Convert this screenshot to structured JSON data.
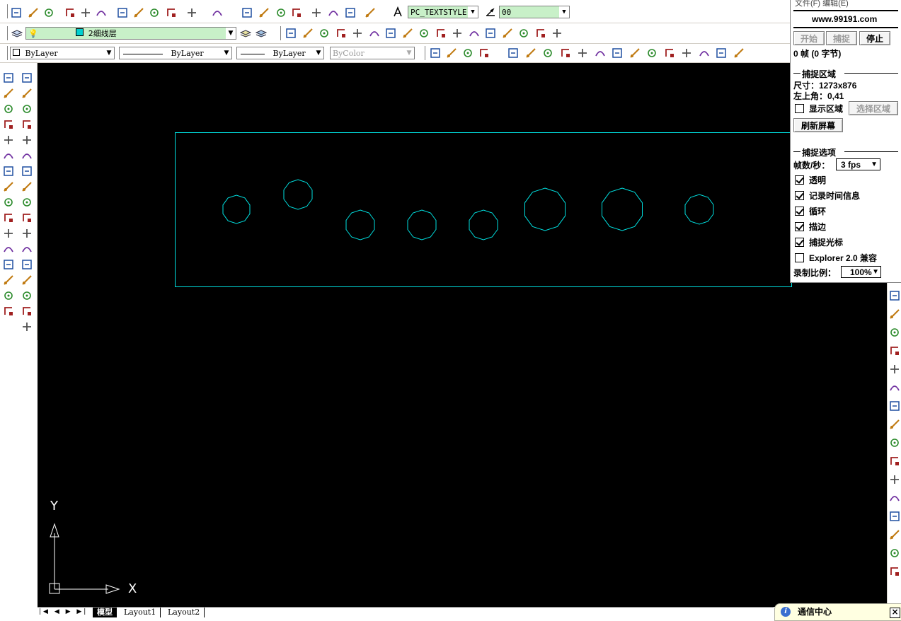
{
  "toolbar": {
    "text_style": "PC_TEXTSTYLE",
    "dim_style": "00",
    "layer_name": "2细线层",
    "color_combo": "ByLayer",
    "linetype_combo": "ByLayer",
    "lineweight_combo": "ByLayer",
    "plotstyle_combo": "ByColor",
    "icons_row1": [
      "new-icon",
      "open-icon",
      "save-icon",
      "print-icon",
      "print-preview-icon",
      "publish-icon",
      "cut-icon",
      "copy-icon",
      "paste-icon",
      "match-properties-icon",
      "undo-icon",
      "redo-icon",
      "pan-icon",
      "zoom-realtime-icon",
      "zoom-window-icon",
      "zoom-previous-icon",
      "properties-icon",
      "design-center-icon",
      "tool-palettes-icon",
      "help-icon"
    ],
    "icons_row2_snap": [
      "temporary-tracking-icon",
      "snap-from-icon",
      "snap-endpoint-icon",
      "snap-midpoint-icon",
      "snap-intersection-icon",
      "snap-apparent-intersection-icon",
      "snap-extension-icon",
      "snap-center-icon",
      "snap-quadrant-icon",
      "snap-tangent-icon",
      "snap-perpendicular-icon",
      "snap-parallel-icon",
      "snap-insert-icon",
      "snap-node-icon",
      "snap-nearest-icon",
      "snap-none-icon",
      "osnap-settings-icon"
    ],
    "icons_row3_ucs": [
      "ucs-icon",
      "named-ucs-icon",
      "ucs-previous-icon",
      "world-ucs-icon",
      "object-ucs-icon",
      "face-ucs-icon",
      "view-ucs-icon",
      "origin-ucs-icon",
      "z-axis-ucs-icon",
      "3point-ucs-icon",
      "x-rotate-ucs-icon",
      "y-rotate-ucs-icon",
      "z-rotate-ucs-icon",
      "apply-ucs-icon"
    ]
  },
  "draw_tools": [
    "line-icon",
    "construction-line-icon",
    "polyline-icon",
    "polygon-icon",
    "rectangle-icon",
    "arc-icon",
    "circle-icon",
    "revision-cloud-icon",
    "spline-icon",
    "ellipse-icon",
    "ellipse-arc-icon",
    "insert-block-icon",
    "make-block-icon",
    "point-icon",
    "hatch-icon",
    "region-icon",
    "text-icon"
  ],
  "modify_tools": [
    "erase-icon",
    "copy-object-icon",
    "mirror-icon",
    "offset-icon",
    "array-icon",
    "move-icon",
    "rotate-icon",
    "scale-icon",
    "stretch-icon",
    "trim-icon",
    "extend-icon",
    "break-at-point-icon",
    "break-icon",
    "chamfer-icon",
    "fillet-icon",
    "explode-icon"
  ],
  "layout_tabs": [
    "模型",
    "Layout1",
    "Layout2"
  ],
  "ucs_labels": {
    "x": "X",
    "y": "Y"
  },
  "drawing": {
    "line_color": "#00e0e0",
    "holes": [
      {
        "label": "small",
        "r": 20
      },
      {
        "label": "small",
        "r": 21
      },
      {
        "label": "small",
        "r": 21
      },
      {
        "label": "small",
        "r": 21
      },
      {
        "label": "small",
        "r": 21
      },
      {
        "label": "large",
        "r": 30
      },
      {
        "label": "large",
        "r": 30
      },
      {
        "label": "small",
        "r": 21
      }
    ]
  },
  "capture_panel": {
    "menu": "文件(F)    编辑(E)",
    "site": "www.99191.com",
    "start_btn": "开始",
    "capture_btn": "捕捉",
    "stop_btn": "停止",
    "frames": "0 帧 (0 字节)",
    "region_header": "捕捉区域",
    "size_label": "尺寸：1273x876",
    "topleft_label": "左上角：0,41",
    "show_region": "显示区域",
    "select_region_btn": "选择区域",
    "refresh_btn": "刷新屏幕",
    "options_header": "捕捉选项",
    "fps_label": "帧数/秒：",
    "fps_value": "3 fps",
    "opt_transparent": "透明",
    "opt_record_time": "记录时间信息",
    "opt_loop": "循环",
    "opt_border": "描边",
    "opt_capture_cursor": "捕捉光标",
    "opt_explorer": "Explorer 2.0 兼容",
    "scale_label": "录制比例：",
    "scale_value": "100%"
  },
  "notification": {
    "label": "通信中心",
    "close": "×"
  }
}
